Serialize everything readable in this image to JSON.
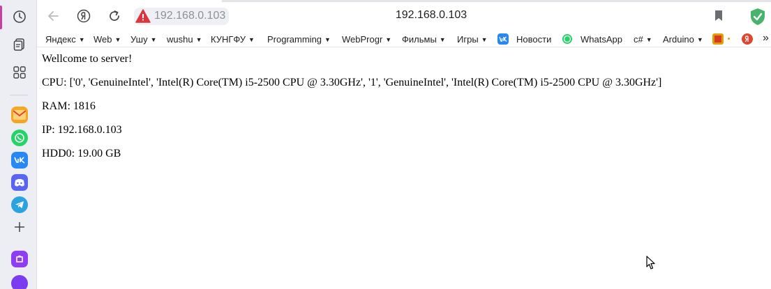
{
  "browser": {
    "address_chip": "192.168.0.103",
    "address_title": "192.168.0.103",
    "accent_color": "#c93fa3",
    "shield_color": "#47b36b",
    "warning_color": "#d9363e"
  },
  "sidepanel": {
    "buttons": [
      "history-icon",
      "collections-icon",
      "apps-grid-icon"
    ],
    "apps": [
      "mail-app",
      "whatsapp-app",
      "vk-app",
      "discord-app",
      "telegram-app",
      "add-app",
      "purple-app",
      "alice-app"
    ]
  },
  "bookmarks": [
    {
      "label": "Яндекс",
      "folder": true
    },
    {
      "label": "Web",
      "folder": true
    },
    {
      "label": "Ушу",
      "folder": true
    },
    {
      "label": "wushu",
      "folder": true
    },
    {
      "label": "КУНГФУ",
      "folder": true
    },
    {
      "label": "Programming",
      "folder": true
    },
    {
      "label": "WebProgr",
      "folder": true
    },
    {
      "label": "Фильмы",
      "folder": true
    },
    {
      "label": "Игры",
      "folder": true
    },
    {
      "label": "Новости",
      "icon": "vk-icon"
    },
    {
      "label": "WhatsApp",
      "icon": "whatsapp-icon"
    },
    {
      "label": "c#",
      "folder": true
    },
    {
      "label": "Arduino",
      "folder": true
    }
  ],
  "bookmark_arrow": "▼",
  "bookmark_overflow": "»",
  "page": {
    "welcome": "Wellcome to server!",
    "cpu": "CPU: ['0', 'GenuineIntel', 'Intel(R) Core(TM) i5-2500 CPU @ 3.30GHz', '1', 'GenuineIntel', 'Intel(R) Core(TM) i5-2500 CPU @ 3.30GHz']",
    "ram": "RAM: 1816",
    "ip": "IP: 192.168.0.103",
    "hdd": "HDD0: 19.00 GB"
  }
}
